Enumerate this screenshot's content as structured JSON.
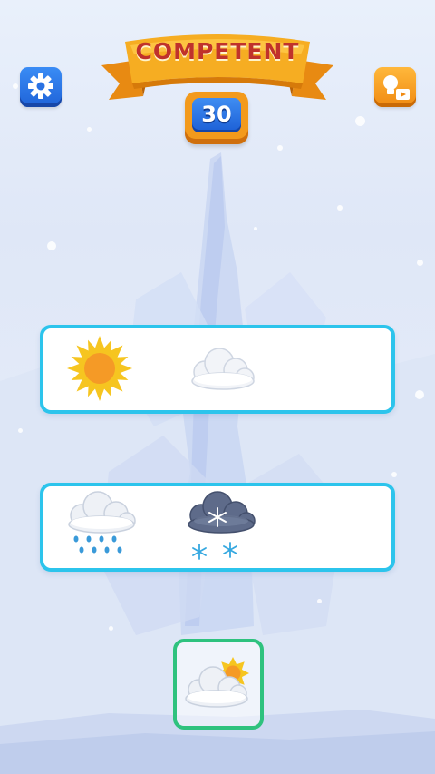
{
  "header": {
    "rank_title": "COMPETENT",
    "level_number": "30"
  },
  "buttons": {
    "settings_icon": "gear-icon",
    "hint_icon": "lightbulb-video-icon"
  },
  "rows": [
    {
      "slots": [
        "sun-icon",
        "cloud-icon"
      ]
    },
    {
      "slots": [
        "rain-cloud-icon",
        "snow-cloud-icon"
      ]
    }
  ],
  "tray": {
    "item": "sun-behind-cloud-icon"
  },
  "colors": {
    "row_border": "#2cc4ec",
    "tray_border": "#2ec27e",
    "ribbon": "#f4a51c",
    "title_text": "#c0322b",
    "level_badge": "#f39a1c",
    "level_inner": "#1c5fd6"
  }
}
